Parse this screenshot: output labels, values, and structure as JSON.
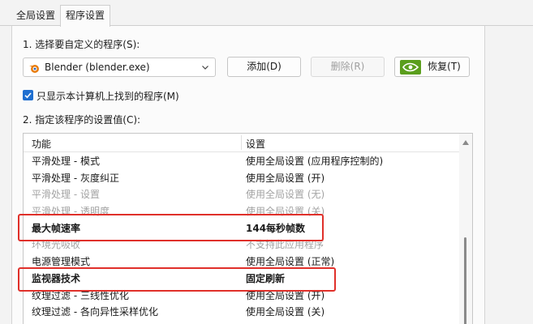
{
  "tabs": [
    {
      "label": "全局设置",
      "active": false
    },
    {
      "label": "程序设置",
      "active": true
    }
  ],
  "section1": {
    "label": "1. 选择要自定义的程序(S):",
    "program_select": {
      "value": "Blender (blender.exe)"
    },
    "add_button": "添加(D)",
    "remove_button": "删除(R)",
    "restore_button": "恢复(T)"
  },
  "checkbox": {
    "label": "只显示本计算机上找到的程序(M)",
    "checked": true
  },
  "section2": {
    "label": "2. 指定该程序的设置值(C):",
    "columns": [
      "功能",
      "设置"
    ],
    "rows": [
      {
        "feature": "平滑处理 - 模式",
        "setting": "使用全局设置 (应用程序控制的)"
      },
      {
        "feature": "平滑处理 - 灰度纠正",
        "setting": "使用全局设置 (开)"
      },
      {
        "feature": "平滑处理 - 设置",
        "setting": "使用全局设置 (无)"
      },
      {
        "feature": "平滑处理 - 透明度",
        "setting": "使用全局设置 (关)"
      },
      {
        "feature": "最大帧速率",
        "setting": "144每秒帧数"
      },
      {
        "feature": "环境光吸收",
        "setting": "不支持此应用程序"
      },
      {
        "feature": "电源管理模式",
        "setting": "使用全局设置 (正常)"
      },
      {
        "feature": "监视器技术",
        "setting": "固定刷新"
      },
      {
        "feature": "纹理过滤 - 三线性优化",
        "setting": "使用全局设置 (开)"
      },
      {
        "feature": "纹理过滤 - 各向异性采样优化",
        "setting": "使用全局设置 (关)"
      }
    ]
  },
  "colors": {
    "accent": "#1f6fd0",
    "highlight": "#e0302a",
    "nvidia": "#5a9e1c"
  }
}
